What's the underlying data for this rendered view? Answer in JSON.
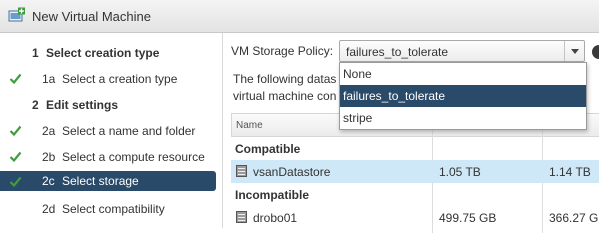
{
  "window": {
    "title": "New Virtual Machine",
    "icon": "new-vm-icon"
  },
  "nav": {
    "items": [
      {
        "num": "1",
        "label": "Select creation type",
        "header": true,
        "done": false,
        "selected": false
      },
      {
        "num": "1a",
        "label": "Select a creation type",
        "header": false,
        "done": true,
        "selected": false
      },
      {
        "num": "2",
        "label": "Edit settings",
        "header": true,
        "done": false,
        "selected": false
      },
      {
        "num": "2a",
        "label": "Select a name and folder",
        "header": false,
        "done": true,
        "selected": false
      },
      {
        "num": "2b",
        "label": "Select a compute resource",
        "header": false,
        "done": true,
        "selected": false
      },
      {
        "num": "2c",
        "label": "Select storage",
        "header": false,
        "done": true,
        "selected": true
      },
      {
        "num": "2d",
        "label": "Select compatibility",
        "header": false,
        "done": false,
        "selected": false
      }
    ]
  },
  "storage": {
    "policy_label": "VM Storage Policy:",
    "policy_value": "failures_to_tolerate",
    "description_line1": "The following datas",
    "description_line2": "virtual machine con",
    "dropdown_options": [
      "None",
      "failures_to_tolerate",
      "stripe"
    ],
    "dropdown_active": "failures_to_tolerate"
  },
  "table": {
    "header_name": "Name",
    "group_compatible": "Compatible",
    "group_incompatible": "Incompatible",
    "rows": [
      {
        "name": "vsanDatastore",
        "capacity": "1.05 TB",
        "provisioned": "1.14 TB",
        "highlighted": true
      },
      {
        "name": "drobo01",
        "capacity": "499.75 GB",
        "provisioned": "366.27 G",
        "highlighted": false
      }
    ]
  },
  "colors": {
    "selection": "#294a69",
    "check": "#3f9d3f",
    "row_highlight": "#cfe8f7"
  }
}
